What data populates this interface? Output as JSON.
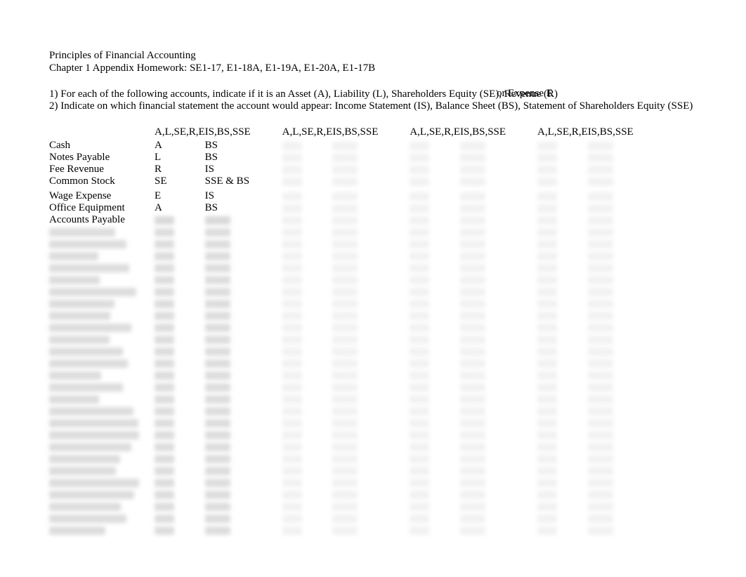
{
  "header": {
    "title": "Principles of Financial Accounting",
    "subtitle": "Chapter 1 Appendix Homework: SE1-17, E1-18A, E1-19A, E1-20A, E1-17B"
  },
  "instructions": {
    "line1": "1) For each of the following accounts, indicate if it is an Asset (A), Liability (L), Shareholders Equity (SE), Revenue (R)",
    "overlap": "or Expense E",
    "line2": "2) Indicate on which financial statement the account would appear: Income Statement (IS), Balance Sheet (BS), Statement of Shareholders Equity (SSE)"
  },
  "columns": {
    "c1": "A,L,SE,R,E",
    "c2": "IS,BS,SSE",
    "c3": "A,L,SE,R,E",
    "c4": "IS,BS,SSE",
    "c5": "A,L,SE,R,E",
    "c6": "IS,BS,SSE",
    "c7": "A,L,SE,R,E",
    "c8": "IS,BS,SSE"
  },
  "rows": [
    {
      "account": "Cash",
      "c1": "A",
      "c2": "BS"
    },
    {
      "account": "Notes Payable",
      "c1": "L",
      "c2": "BS"
    },
    {
      "account": "Fee Revenue",
      "c1": "R",
      "c2": "IS"
    },
    {
      "account": "Common Stock",
      "c1": "SE",
      "c2": "SSE & BS"
    },
    {
      "gap": true
    },
    {
      "account": "Wage Expense",
      "c1": "E",
      "c2": "IS"
    },
    {
      "account": "Office Equipment",
      "c1": "A",
      "c2": "BS"
    },
    {
      "account": "Accounts Payable",
      "c1": "",
      "c2": ""
    }
  ],
  "blurred_row_count": 26
}
